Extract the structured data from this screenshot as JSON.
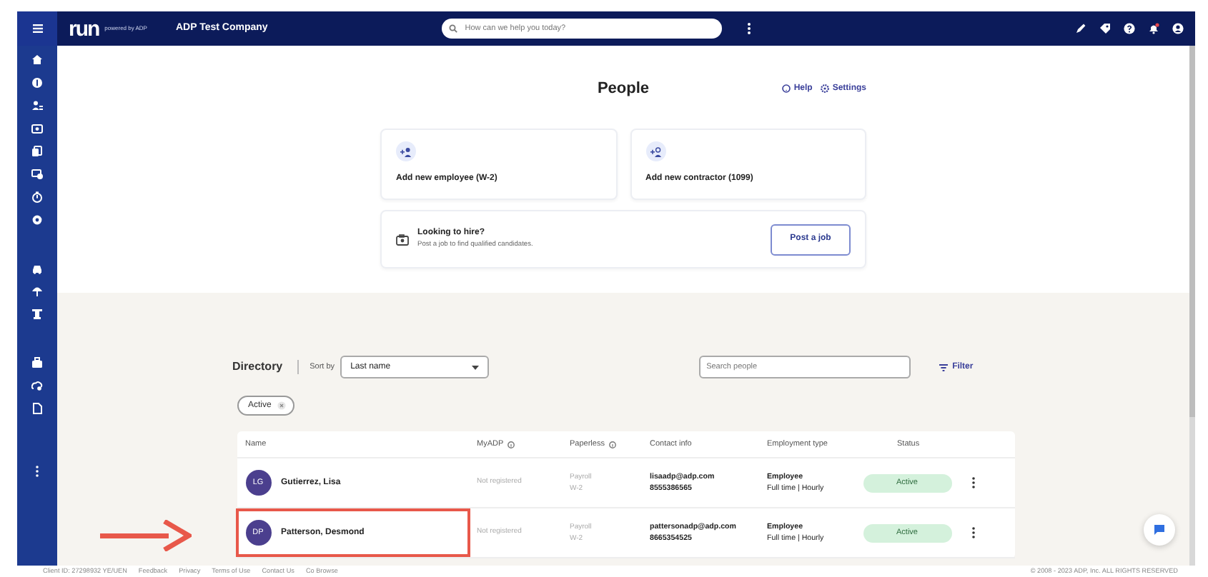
{
  "header": {
    "logo": "run",
    "logo_tagline": "powered by ADP",
    "company": "ADP Test Company",
    "search": {
      "placeholder": "How can we help you today?"
    }
  },
  "page": {
    "title": "People",
    "links": [
      "Help",
      "Settings"
    ]
  },
  "add_cards": [
    {
      "label": "Add new employee (W-2)"
    },
    {
      "label": "Add new contractor (1099)"
    }
  ],
  "hire": {
    "title": "Looking to hire?",
    "text": "Post a job to find qualified candidates.",
    "button": "Post a job"
  },
  "directory": {
    "title": "Directory",
    "sort_label": "Sort by",
    "sort_value": "Last name",
    "search_placeholder": "Search people",
    "filter": "Filter",
    "chip": "Active"
  },
  "table": {
    "columns": [
      {
        "label": "Name",
        "kind": "plain"
      },
      {
        "label": "MyADP",
        "kind": "info"
      },
      {
        "label": "Paperless",
        "kind": "info"
      },
      {
        "label": "Contact info",
        "kind": "plain"
      },
      {
        "label": "Employment type",
        "kind": "plain"
      },
      {
        "label": "Status",
        "kind": "plain"
      }
    ],
    "rows": [
      {
        "initials": "LG",
        "name": "Gutierrez, Lisa",
        "myadp": "Not registered",
        "paperless": [
          "Payroll",
          "W-2"
        ],
        "email": "lisaadp@adp.com",
        "phone": "8555386565",
        "type": "Employee",
        "schedule": "Full time | Hourly",
        "status": "Active",
        "highlighted": false
      },
      {
        "initials": "DP",
        "name": "Patterson, Desmond",
        "myadp": "Not registered",
        "paperless": [
          "Payroll",
          "W-2"
        ],
        "email": "pattersonadp@adp.com",
        "phone": "8665354525",
        "type": "Employee",
        "schedule": "Full time | Hourly",
        "status": "Active",
        "highlighted": true
      }
    ]
  },
  "footer": {
    "client_id": "Client ID: 27298932 YE/UEN",
    "links": [
      "Feedback",
      "Privacy",
      "Terms of Use",
      "Contact Us",
      "Co Browse"
    ],
    "copyright": "© 2008 - 2023 ADP, Inc. ALL RIGHTS RESERVED"
  }
}
